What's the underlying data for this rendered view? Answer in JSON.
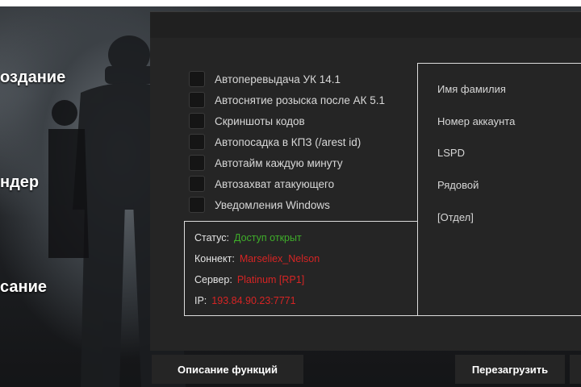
{
  "side_menu": {
    "item1": "оздание",
    "item2": "ндер",
    "item3": "сание"
  },
  "checkboxes": [
    {
      "label": "Автоперевыдача УК 14.1",
      "checked": false
    },
    {
      "label": "Автоснятие розыска после АК 5.1",
      "checked": false
    },
    {
      "label": "Скриншоты кодов",
      "checked": false
    },
    {
      "label": "Автопосадка в КПЗ (/arest id)",
      "checked": false
    },
    {
      "label": "Автотайм каждую минуту",
      "checked": false
    },
    {
      "label": "Автозахват атакующего",
      "checked": false
    },
    {
      "label": "Уведомления Windows",
      "checked": false
    }
  ],
  "status": {
    "status_key": "Статус:",
    "status_value": "Доступ открыт",
    "connect_key": "Коннект:",
    "connect_value": "Marseliex_Nelson",
    "server_key": "Сервер:",
    "server_value": "Platinum [RP1]",
    "ip_key": "IP:",
    "ip_value": "193.84.90.23:7771",
    "colors": {
      "ok": "#3fae2a",
      "value": "#d62424"
    }
  },
  "info": {
    "name": "Имя фамилия",
    "account": "Номер аккаунта",
    "faction": "LSPD",
    "rank": "Рядовой",
    "department": "[Отдел]"
  },
  "buttons": {
    "functions": "Описание функций",
    "reload": "Перезагрузить"
  }
}
